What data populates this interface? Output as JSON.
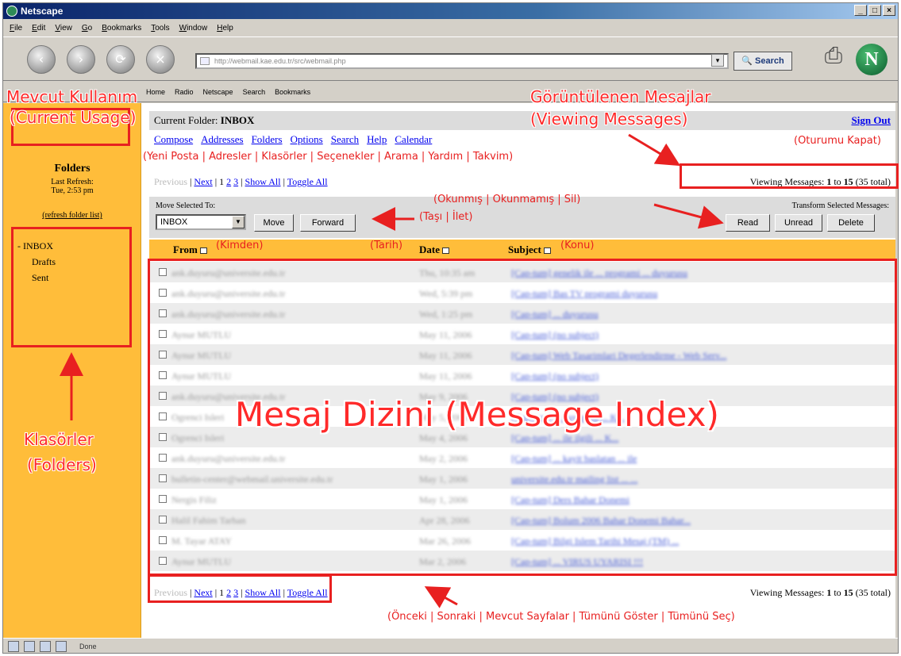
{
  "window": {
    "title": "Netscape",
    "controls": [
      "_",
      "□",
      "×"
    ]
  },
  "menu": [
    "File",
    "Edit",
    "View",
    "Go",
    "Bookmarks",
    "Tools",
    "Window",
    "Help"
  ],
  "nav": {
    "url": "http://webmail.kae.edu.tr/src/webmail.php",
    "search_label": "Search",
    "back": "‹",
    "forward": "›",
    "reload": "⟳",
    "stop": "×"
  },
  "personal_toolbar": [
    "Home",
    "Radio",
    "Netscape",
    "Search",
    "Bookmarks"
  ],
  "left": {
    "folders_title": "Folders",
    "last_refresh_label": "Last Refresh:",
    "last_refresh_time": "Tue, 2:53 pm",
    "refresh_link": "(refresh folder list)",
    "folders": [
      {
        "name": "INBOX",
        "level": 0
      },
      {
        "name": "Drafts",
        "level": 1
      },
      {
        "name": "Sent",
        "level": 1
      }
    ]
  },
  "main": {
    "current_folder_label": "Current Folder:",
    "current_folder": "INBOX",
    "sign_out": "Sign Out",
    "links": [
      "Compose",
      "Addresses",
      "Folders",
      "Options",
      "Search",
      "Help",
      "Calendar"
    ],
    "pager_top": {
      "previous": "Previous",
      "next": "Next",
      "current": "1",
      "pages": [
        "2",
        "3"
      ],
      "show_all": "Show All",
      "toggle_all": "Toggle All"
    },
    "viewing": {
      "label": "Viewing Messages:",
      "from": "1",
      "to_word": "to",
      "to": "15",
      "total": "(35 total)"
    },
    "move_label": "Move Selected To:",
    "move_select": "INBOX",
    "move_button": "Move",
    "forward_button": "Forward",
    "transform_label": "Transform Selected Messages:",
    "read_button": "Read",
    "unread_button": "Unread",
    "delete_button": "Delete",
    "col_from": "From",
    "col_date": "Date",
    "col_subject": "Subject",
    "messages": [
      {
        "from": "ank.duyuru@universite.edu.tr",
        "date": "Thu, 10:35 am",
        "subject": "[Cap-tum] genelik ile ... programi ... duyurusu"
      },
      {
        "from": "ank.duyuru@universite.edu.tr",
        "date": "Wed, 5:39 pm",
        "subject": "[Cap-tum] Bas TV programi duyurusu"
      },
      {
        "from": "ank.duyuru@universite.edu.tr",
        "date": "Wed, 1:25 pm",
        "subject": "[Cap-tum] ... duyurusu"
      },
      {
        "from": "Aynur MUTLU",
        "date": "May 11, 2006",
        "subject": "[Cap-tum] (no subject)"
      },
      {
        "from": "Aynur MUTLU",
        "date": "May 11, 2006",
        "subject": "[Cap-tum] Web Tasarimlari Degerlendirme - Web Serv..."
      },
      {
        "from": "Aynur MUTLU",
        "date": "May 11, 2006",
        "subject": "[Cap-tum] (no subject)"
      },
      {
        "from": "ank.duyuru@universite.edu.tr",
        "date": "May 9, 2006",
        "subject": "[Cap-tum] (no subject)"
      },
      {
        "from": "Ogrenci Isleri",
        "date": "May 5, 2006",
        "subject": "[Cap-tum] ... duyurusu ... K..."
      },
      {
        "from": "Ogrenci Isleri",
        "date": "May 4, 2006",
        "subject": "[Cap-tum] ... ile ilgili ... K..."
      },
      {
        "from": "ank.duyuru@universite.edu.tr",
        "date": "May 2, 2006",
        "subject": "[Cap-tum] ... kayit baslatan ... ile"
      },
      {
        "from": "bulletin-center@webmail.universite.edu.tr",
        "date": "May 1, 2006",
        "subject": "universite.edu.tr mailing list ... ..."
      },
      {
        "from": "Nergis Filiz",
        "date": "May 1, 2006",
        "subject": "[Cap-tum] Ders Bahar Donemi"
      },
      {
        "from": "Halil Fahim Tarhan",
        "date": "Apr 28, 2006",
        "subject": "[Cap-tum] Bolum 2006 Bahar Donemi Bahar..."
      },
      {
        "from": "M. Tayar ATAY",
        "date": "Mar 26, 2006",
        "subject": "[Cap-tum] Bilgi Islem Tarihi Mesaj (TM) ..."
      },
      {
        "from": "Aynur MUTLU",
        "date": "Mar 2, 2006",
        "subject": "[Cap-tum] ... VIRUS UYARISI !!!"
      }
    ]
  },
  "annotations": {
    "current_usage_tr": "Mevcut Kullanım",
    "current_usage_en": "(Current Usage)",
    "viewing_tr": "Görüntülenen Mesajlar",
    "viewing_en": "(Viewing Messages)",
    "signout_tr": "(Oturumu Kapat)",
    "links_tr": "(Yeni Posta | Adresler | Klasörler | Seçenekler | Arama | Yardım | Takvim)",
    "transform_tr": "(Okunmış | Okunmamış | Sil)",
    "move_tr": "(Taşı | İlet)",
    "from_tr": "(Kimden)",
    "date_tr": "(Tarih)",
    "subject_tr": "(Konu)",
    "index": "Mesaj Dizini (Message Index)",
    "folders_tr": "Klasörler",
    "folders_en": "(Folders)",
    "pager_tr": "(Önceki | Sonraki | Mevcut Sayfalar | Tümünü Göster | Tümünü Seç)"
  },
  "status": {
    "text": "Done"
  },
  "colors": {
    "sidebar": "#ffbd3a",
    "annotation": "#e82020",
    "link": "#0000ee"
  }
}
